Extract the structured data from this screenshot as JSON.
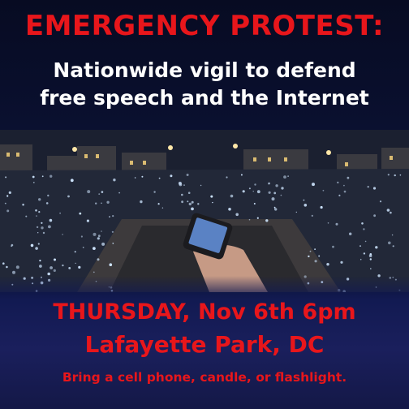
{
  "poster": {
    "headline": "EMERGENCY PROTEST:",
    "subhead_line1": "Nationwide vigil to defend",
    "subhead_line2": "free speech and the Internet",
    "date_time": "THURSDAY, Nov 6th 6pm",
    "location": "Lafayette Park, DC",
    "bring": "Bring a cell phone, candle, or flashlight."
  },
  "colors": {
    "headline": "#e8161b",
    "subhead": "#ffffff",
    "background": "#0b1233"
  },
  "photo": {
    "description_icon": "crowd-with-phones-photo"
  }
}
